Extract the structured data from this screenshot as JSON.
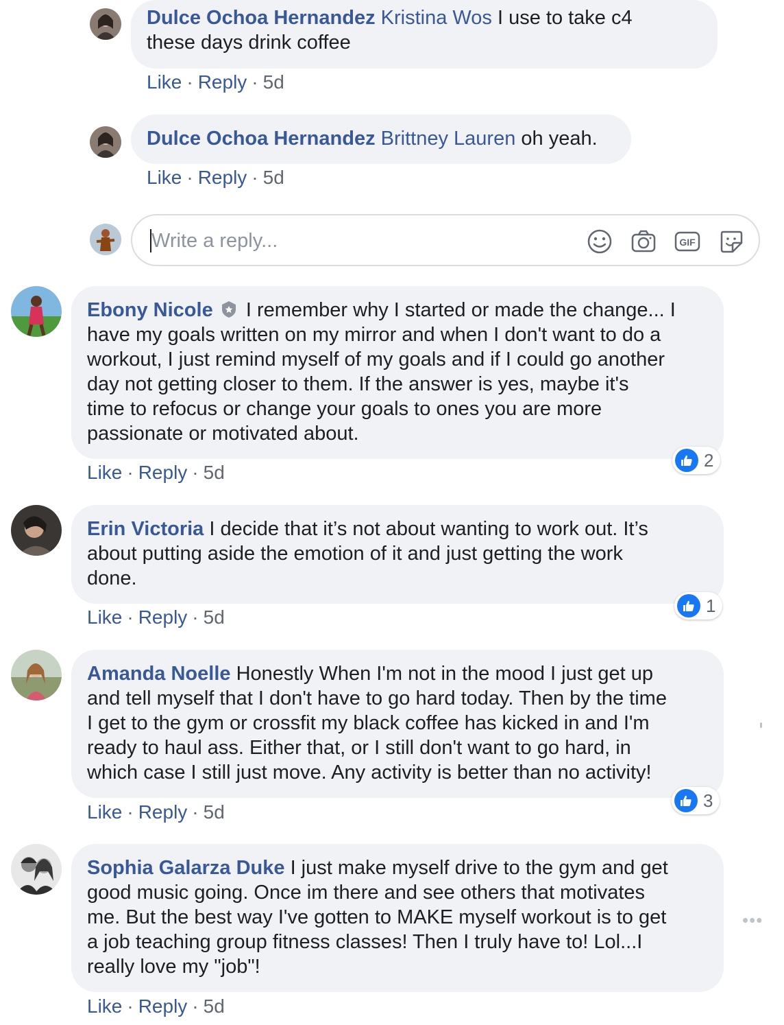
{
  "comments": [
    {
      "author": "Dulce Ochoa Hernandez",
      "mention": "Kristina Wos",
      "text": "I use to take c4 these days drink coffee",
      "text_line1": "I use to take c4",
      "text_line2": "these days drink coffee",
      "like": "Like",
      "reply": "Reply",
      "age": "5d"
    },
    {
      "author": "Dulce Ochoa Hernandez",
      "mention": "Brittney Lauren",
      "text": "oh yeah.",
      "like": "Like",
      "reply": "Reply",
      "age": "5d"
    },
    {
      "author": "Ebony Nicole",
      "badge": "shield-badge-icon",
      "text": "I remember why I started or made the change... I have my goals written on my mirror and when I don't want to do a workout, I just remind myself of my goals and if I could go another day not getting closer to them. If the answer is yes, maybe it's time to refocus or change your goals to ones you are more passionate or motivated about.",
      "lines": [
        "I remember why I started or made the change... I",
        "have my goals written on my mirror and when I don't want to do a",
        "workout, I just remind myself of my goals and if I could go another",
        "day not getting closer to them. If the answer is yes, maybe it's",
        "time to refocus or change your goals to ones you are more",
        "passionate or motivated about."
      ],
      "like": "Like",
      "reply": "Reply",
      "age": "5d",
      "reactions": "2"
    },
    {
      "author": "Erin Victoria",
      "text": "I decide that it’s not about wanting to work out. It’s about putting aside the emotion of it and just getting the work done.",
      "lines": [
        "I decide that it’s not about wanting to work out. It’s",
        "about putting aside the emotion of it and just getting the work",
        "done."
      ],
      "like": "Like",
      "reply": "Reply",
      "age": "5d",
      "reactions": "1"
    },
    {
      "author": "Amanda Noelle",
      "text": "Honestly When I'm not in the mood I just get up and tell myself that I don't have to go hard today. Then by the time I get to the gym or crossfit my black coffee has kicked in and I'm ready to haul ass. Either that, or I still don't want to go hard, in which case I still just move. Any activity is better than no activity!",
      "lines": [
        "Honestly When I'm not in the mood I just get up",
        "and tell myself that I don't have to go hard today. Then by the time",
        "I get to the gym or crossfit my black coffee has kicked in and I'm",
        "ready to haul ass. Either that, or I still don't want to go hard, in",
        "which case I still just move. Any activity is better than no activity!"
      ],
      "like": "Like",
      "reply": "Reply",
      "age": "5d",
      "reactions": "3"
    },
    {
      "author": "Sophia Galarza Duke",
      "text": "I just make myself drive to the gym and get good music going. Once im there and see others that motivates me. But the best way I've gotten to MAKE myself workout is to get a job teaching group fitness classes! Then I truly have to! Lol...I really love my \"job\"!",
      "lines": [
        "I just make myself drive to the gym and get",
        "good music going. Once im there and see others that motivates",
        "me. But the best way I've gotten to MAKE myself workout is to get",
        "a job teaching group fitness classes! Then I truly have to! Lol...I",
        "really love my \"job\"!"
      ],
      "like": "Like",
      "reply": "Reply",
      "age": "5d"
    }
  ],
  "reply_box": {
    "placeholder": "Write a reply...",
    "icons": [
      "emoji-icon",
      "camera-icon",
      "gif-icon",
      "sticker-icon"
    ],
    "gif_label": "GIF"
  },
  "more_options": "•••",
  "colors": {
    "link": "#385898",
    "bubble": "#f0f2f5",
    "like_blue": "#1877f2"
  }
}
